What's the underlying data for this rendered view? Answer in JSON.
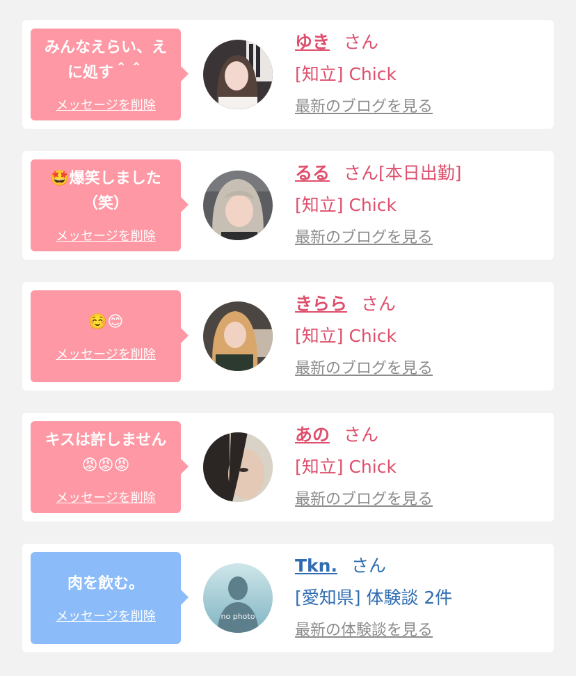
{
  "messages": [
    {
      "theme": "pink",
      "text": "みんなえらい、え\nに処す＾＾",
      "delete_label": "メッセージを削除",
      "name": "ゆき",
      "honorific": "さん",
      "location": "[知立] Chick",
      "link_label": "最新のブログを見る",
      "avatar_icon": "profile-photo-icon"
    },
    {
      "theme": "pink",
      "text": "🤩爆笑しました\n（笑）",
      "delete_label": "メッセージを削除",
      "name": "るる",
      "honorific": "さん[本日出勤]",
      "location": "[知立] Chick",
      "link_label": "最新のブログを見る",
      "avatar_icon": "profile-photo-icon"
    },
    {
      "theme": "pink",
      "text": "☺️😊",
      "delete_label": "メッセージを削除",
      "name": "きらら",
      "honorific": "さん",
      "location": "[知立] Chick",
      "link_label": "最新のブログを見る",
      "avatar_icon": "profile-photo-icon"
    },
    {
      "theme": "pink",
      "text": "キスは許しません\n😡😡😡",
      "delete_label": "メッセージを削除",
      "name": "あの",
      "honorific": "さん",
      "location": "[知立] Chick",
      "link_label": "最新のブログを見る",
      "avatar_icon": "profile-photo-icon"
    },
    {
      "theme": "blue",
      "text": "肉を飲む。",
      "delete_label": "メッセージを削除",
      "name": "Tkn.",
      "honorific": "さん",
      "location": "[愛知県] 体験談 2件",
      "link_label": "最新の体験談を見る",
      "avatar_icon": "no-photo-icon",
      "avatar_caption": "no photo"
    }
  ],
  "colors": {
    "page_bg": "#f2f2f2",
    "bubble_pink": "#fe98a4",
    "bubble_blue": "#8bbcf9",
    "name_pink": "#dd4f6c",
    "name_blue": "#2f6cb1",
    "link_gray": "#8c8c8c"
  }
}
